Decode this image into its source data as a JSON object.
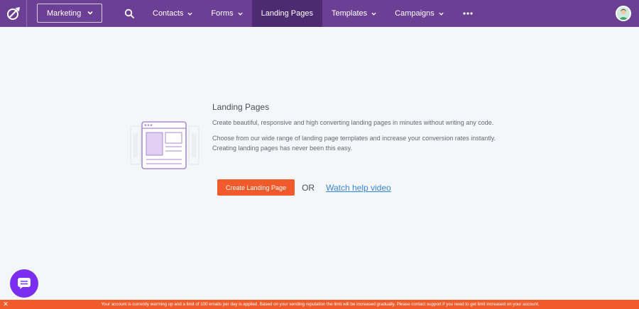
{
  "header": {
    "workspace_select": "Marketing",
    "nav": [
      {
        "label": "Contacts",
        "dropdown": true
      },
      {
        "label": "Forms",
        "dropdown": true
      },
      {
        "label": "Landing Pages",
        "dropdown": false,
        "active": true
      },
      {
        "label": "Templates",
        "dropdown": true
      },
      {
        "label": "Campaigns",
        "dropdown": true
      }
    ],
    "icons": {
      "logo": "brand-logo-icon",
      "search": "search-icon",
      "more": "more-horizontal-icon",
      "avatar": "user-avatar"
    }
  },
  "empty_state": {
    "title": "Landing Pages",
    "description_1": "Create beautiful, responsive and high converting landing pages in minutes without writing any code.",
    "description_2": "Choose from our wide range of landing page templates and increase your conversion rates instantly. Creating landing pages has never been this easy.",
    "create_button": "Create Landing Page",
    "or_text": "OR",
    "help_link": "Watch help video",
    "illustration": "landing-page-illustration"
  },
  "chat": {
    "icon": "chat-bubble-icon"
  },
  "warning": {
    "close_icon": "close-icon",
    "text": "Your account is currently warming up and a limit of 100 emails per day is applied. Based on your sending reputation the limit will be increased gradually. Please contact support if you need to get limit increased on your account."
  },
  "colors": {
    "topbar": "#6b3f93",
    "nav_active": "#4d2a72",
    "accent_orange": "#f15a2b",
    "link_blue": "#3a86d6",
    "chat_purple": "#7b2ef0",
    "background": "#f4f7f9"
  }
}
